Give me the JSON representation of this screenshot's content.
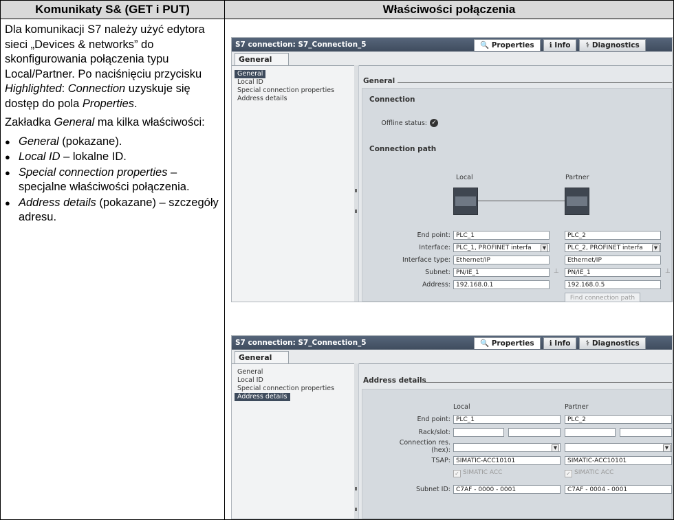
{
  "header": {
    "left_title": "Komunikaty S& (GET i PUT)",
    "right_title": "Właściwości połączenia"
  },
  "left": {
    "p1": "Dla komunikacji S7 należy użyć edytora sieci „Devices & networks” do skonfigurowania połączenia typu Local/Partner. Po naciśnięciu przycisku ",
    "p1_highlighted": "Highlighted",
    "p1_colon": ": ",
    "p1_connection": "Connection",
    "p1_mid": " uzyskuje się dostęp do pola ",
    "p1_properties": "Properties",
    "p1_end": ".",
    "p2_a": "Zakładka ",
    "p2_general": "General",
    "p2_b": " ma kilka właściwości:",
    "bullets": [
      {
        "term": "General",
        "rest": " (pokazane)."
      },
      {
        "term": "Local ID",
        "rest": " – lokalne ID."
      },
      {
        "term": "Special connection properties",
        "rest": " – specjalne właściwości połączenia."
      },
      {
        "term": "Address details",
        "rest": " (pokazane) – szczegóły adresu."
      }
    ]
  },
  "common": {
    "window_title": "S7 connection: S7_Connection_5",
    "tab_properties": "Properties",
    "tab_info": "Info",
    "tab_diagnostics": "Diagnostics",
    "general_tab": "General",
    "nav": [
      "General",
      "Local ID",
      "Special connection properties",
      "Address details"
    ]
  },
  "panel1": {
    "section": "General",
    "connection": "Connection",
    "offline_label": "Offline status:",
    "path": "Connection path",
    "local": "Local",
    "partner": "Partner",
    "rows": [
      {
        "label": "End point:",
        "local": "PLC_1",
        "partner": "PLC_2"
      },
      {
        "label": "Interface:",
        "local": "PLC_1, PROFINET interfa",
        "partner": "PLC_2, PROFINET interfa"
      },
      {
        "label": "Interface type:",
        "local": "Ethernet/IP",
        "partner": "Ethernet/IP"
      },
      {
        "label": "Subnet:",
        "local": "PN/IE_1",
        "partner": "PN/IE_1"
      },
      {
        "label": "Address:",
        "local": "192.168.0.1",
        "partner": "192.168.0.5"
      }
    ],
    "find_button": "Find connection path"
  },
  "panel2": {
    "section": "Address details",
    "local": "Local",
    "partner": "Partner",
    "end_point_label": "End point:",
    "end_local": "PLC_1",
    "end_partner": "PLC_2",
    "rack_label": "Rack/slot:",
    "connres_label1": "Connection res.",
    "connres_label2": "(hex):",
    "tsap_label": "TSAP:",
    "tsap_local": "SIMATIC-ACC10101",
    "tsap_partner": "SIMATIC-ACC10101",
    "simatic_acc": "SIMATIC ACC",
    "subnetid_label": "Subnet ID:",
    "subnetid_local": "C7AF - 0000 - 0001",
    "subnetid_partner": "C7AF - 0004 - 0001"
  }
}
